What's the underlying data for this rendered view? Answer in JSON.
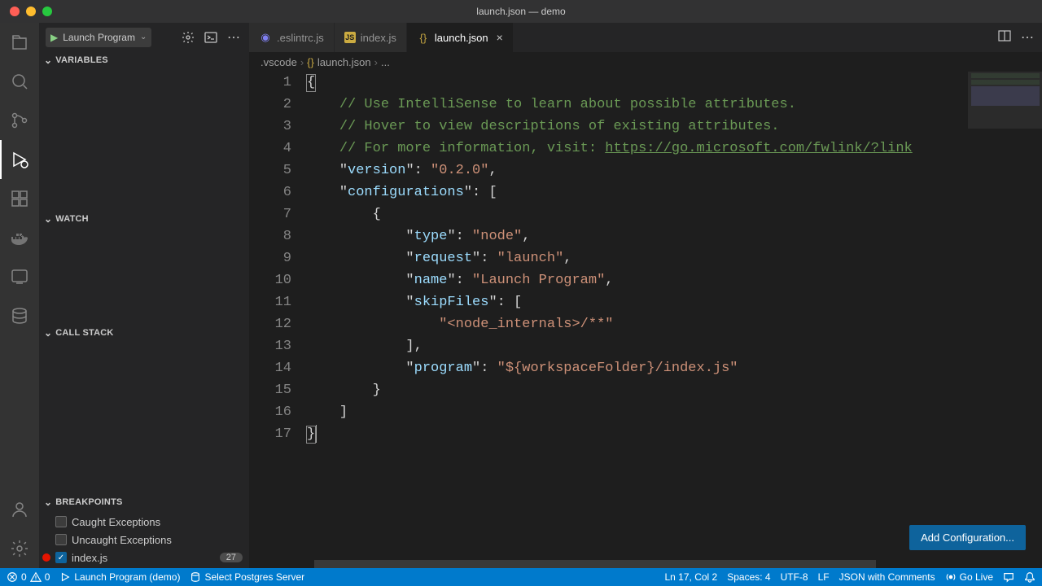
{
  "window": {
    "title": "launch.json — demo"
  },
  "debug": {
    "config_selected": "Launch Program"
  },
  "sidebar": {
    "sections": {
      "variables": "VARIABLES",
      "watch": "WATCH",
      "callstack": "CALL STACK",
      "breakpoints": "BREAKPOINTS"
    },
    "breakpoints": {
      "caught": {
        "label": "Caught Exceptions",
        "checked": false
      },
      "uncaught": {
        "label": "Uncaught Exceptions",
        "checked": false
      },
      "file": {
        "label": "index.js",
        "checked": true,
        "line": "27"
      }
    }
  },
  "tabs": [
    {
      "label": ".eslintrc.js",
      "icon": "eslint",
      "active": false,
      "closeable": false
    },
    {
      "label": "index.js",
      "icon": "js",
      "active": false,
      "closeable": false
    },
    {
      "label": "launch.json",
      "icon": "json",
      "active": true,
      "closeable": true
    }
  ],
  "breadcrumbs": {
    "folder": ".vscode",
    "file": "launch.json",
    "trail": "..."
  },
  "editor": {
    "line_count": 17,
    "lines": [
      {
        "n": 1,
        "html": "<span class='tok-punc bracket-hl'>{</span>"
      },
      {
        "n": 2,
        "html": "    <span class='tok-comment'>// Use IntelliSense to learn about possible attributes.</span>"
      },
      {
        "n": 3,
        "html": "    <span class='tok-comment'>// Hover to view descriptions of existing attributes.</span>"
      },
      {
        "n": 4,
        "html": "    <span class='tok-comment'>// For more information, visit: </span><span class='tok-link'>https://go.microsoft.com/fwlink/?link</span>"
      },
      {
        "n": 5,
        "html": "    <span class='tok-punc'>\"</span><span class='tok-key'>version</span><span class='tok-punc'>\": </span><span class='tok-string'>\"0.2.0\"</span><span class='tok-punc'>,</span>"
      },
      {
        "n": 6,
        "html": "    <span class='tok-punc'>\"</span><span class='tok-key'>configurations</span><span class='tok-punc'>\": [</span>"
      },
      {
        "n": 7,
        "html": "        <span class='tok-punc'>{</span>"
      },
      {
        "n": 8,
        "html": "            <span class='tok-punc'>\"</span><span class='tok-key'>type</span><span class='tok-punc'>\": </span><span class='tok-string'>\"node\"</span><span class='tok-punc'>,</span>"
      },
      {
        "n": 9,
        "html": "            <span class='tok-punc'>\"</span><span class='tok-key'>request</span><span class='tok-punc'>\": </span><span class='tok-string'>\"launch\"</span><span class='tok-punc'>,</span>"
      },
      {
        "n": 10,
        "html": "            <span class='tok-punc'>\"</span><span class='tok-key'>name</span><span class='tok-punc'>\": </span><span class='tok-string'>\"Launch Program\"</span><span class='tok-punc'>,</span>"
      },
      {
        "n": 11,
        "html": "            <span class='tok-punc'>\"</span><span class='tok-key'>skipFiles</span><span class='tok-punc'>\": [</span>"
      },
      {
        "n": 12,
        "html": "                <span class='tok-string'>\"&lt;node_internals&gt;/**\"</span>"
      },
      {
        "n": 13,
        "html": "            <span class='tok-punc'>],</span>"
      },
      {
        "n": 14,
        "html": "            <span class='tok-punc'>\"</span><span class='tok-key'>program</span><span class='tok-punc'>\": </span><span class='tok-string'>\"${workspaceFolder}/index.js\"</span>"
      },
      {
        "n": 15,
        "html": "        <span class='tok-punc'>}</span>"
      },
      {
        "n": 16,
        "html": "    <span class='tok-punc'>]</span>"
      },
      {
        "n": 17,
        "html": "<span class='tok-punc bracket-hl'>}</span><span class='cursor-line'></span>"
      }
    ],
    "add_config_label": "Add Configuration..."
  },
  "status": {
    "errors": "0",
    "warnings": "0",
    "launch": "Launch Program (demo)",
    "postgres": "Select Postgres Server",
    "position": "Ln 17, Col 2",
    "spaces": "Spaces: 4",
    "encoding": "UTF-8",
    "eol": "LF",
    "lang": "JSON with Comments",
    "golive": "Go Live"
  }
}
